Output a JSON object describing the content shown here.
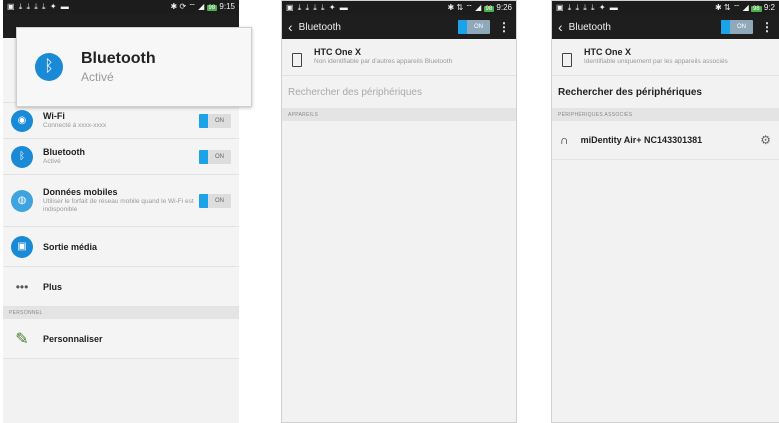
{
  "colors": {
    "accent": "#1aa3e8",
    "statusbar": "#1c1c1c",
    "actionbar": "#1e1e1e",
    "battery": "#4caf50"
  },
  "phone1": {
    "status": {
      "left": "▣ ⤓ ⤓ ⤓ ⤓ ✦ ▬",
      "right": "✱ ⟳ ⌔ ◢",
      "battery": "98",
      "time": "9:15"
    },
    "popup": {
      "title": "Bluetooth",
      "subtitle": "Activé"
    },
    "rows": [
      {
        "title": "Wi-Fi",
        "sub": "Connecté à xxxx-xxxx",
        "toggle": "ON",
        "icon": "wifi-icon"
      },
      {
        "title": "Bluetooth",
        "sub": "Activé",
        "toggle": "ON",
        "icon": "bluetooth-icon"
      },
      {
        "title": "Données mobiles",
        "sub": "Utiliser le forfait de réseau mobile quand le Wi-Fi est indisponible",
        "toggle": "ON",
        "icon": "mobile-data-icon"
      },
      {
        "title": "Sortie média",
        "icon": "media-output-icon"
      },
      {
        "title": "Plus",
        "icon": "more-icon"
      }
    ],
    "section_personal": "PERSONNEL",
    "personalize": {
      "title": "Personnaliser",
      "icon": "brush-icon"
    }
  },
  "phone2": {
    "status": {
      "left": "▣ ⤓ ⤓ ⤓ ⤓ ✦ ▬",
      "right": "✱ ⇅ ⌔ ◢",
      "battery": "98",
      "time": "9:26"
    },
    "title": "Bluetooth",
    "toggle": "ON",
    "device": {
      "name": "HTC One X",
      "desc": "Non identifiable par d'autres appareils Bluetooth"
    },
    "search": "Rechercher des périphériques",
    "section": "APPAREILS"
  },
  "phone3": {
    "status": {
      "left": "▣ ⤓ ⤓ ⤓ ⤓ ✦ ▬",
      "right": "✱ ⇅ ⌔ ◢",
      "battery": "98",
      "time": "9:2"
    },
    "title": "Bluetooth",
    "toggle": "ON",
    "device": {
      "name": "HTC One X",
      "desc": "Identifiable uniquement par les appareils associés"
    },
    "search": "Rechercher des périphériques",
    "section": "PÉRIPHÉRIQUES ASSOCIÉS",
    "paired": {
      "name": "miDentity Air+ NC143301381",
      "icon": "headphones-icon",
      "settings_icon": "gear-icon"
    }
  }
}
